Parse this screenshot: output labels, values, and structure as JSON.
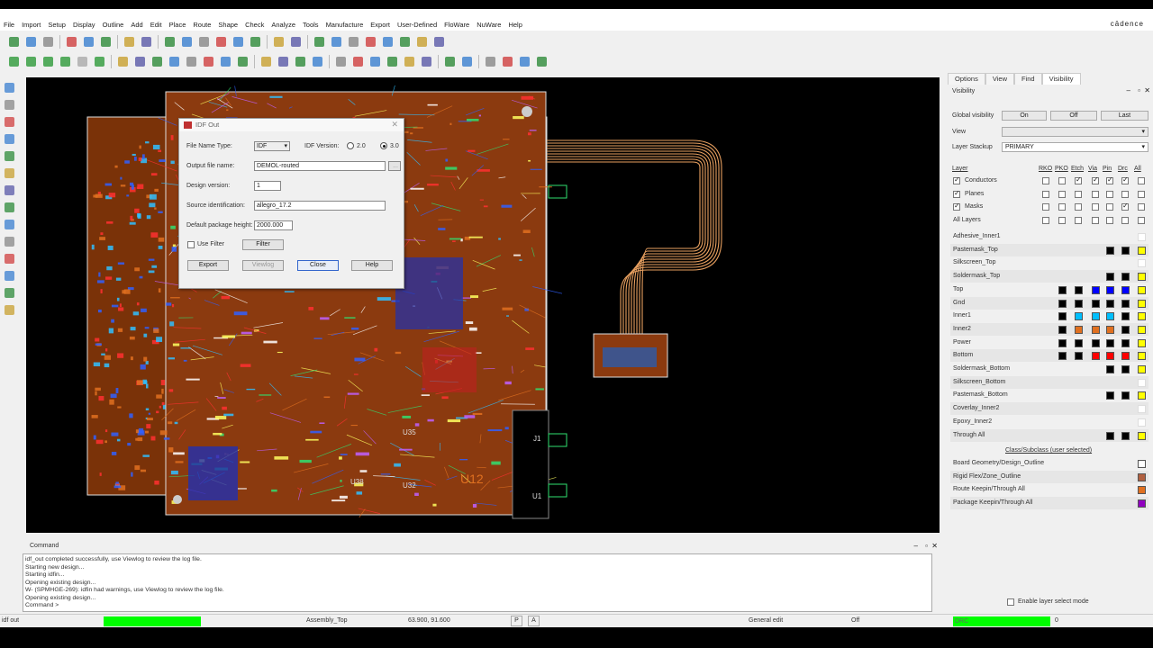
{
  "brand": "cādence",
  "menu": [
    "File",
    "Import",
    "Setup",
    "Display",
    "Outline",
    "Add",
    "Edit",
    "Place",
    "Route",
    "Shape",
    "Check",
    "Analyze",
    "Tools",
    "Manufacture",
    "Export",
    "User-Defined",
    "FloWare",
    "NuWare",
    "Help"
  ],
  "toolbar_row1_icons": [
    "new-icon",
    "open-icon",
    "save-icon",
    "move-icon",
    "copy-icon",
    "delete-icon",
    "undo-icon",
    "redo-icon",
    "zoom-fit-icon",
    "zoom-in-icon",
    "zoom-out-icon",
    "zoom-world-icon",
    "zoom-previous-icon",
    "redraw-icon",
    "3d-icon",
    "refresh-icon",
    "info-icon",
    "property-icon",
    "light-icon",
    "grid-icon",
    "sun-icon",
    "shape-icon",
    "drc-icon",
    "cross-icon"
  ],
  "toolbar_row2_icons": [
    "layer-green-icon",
    "layer-green-icon",
    "layer-green-icon",
    "layer-green-icon",
    "layer-gray-icon",
    "layer-green-icon",
    "add-line-icon",
    "add-rect-icon",
    "add-circle-icon",
    "add-frect-icon",
    "add-shape-icon",
    "add-void-icon",
    "add-text-icon",
    "add-via-icon",
    "place-icon",
    "dimension-icon",
    "fanout-icon",
    "spread-icon",
    "swap-icon",
    "align-icon",
    "group-icon",
    "route-icon",
    "slide-icon",
    "glossing-icon",
    "show-element-icon",
    "drc-marker-icon",
    "manufacturing-icon",
    "artwork-icon",
    "view-icon",
    "3d-view-icon"
  ],
  "canvas_labels": [
    "U35",
    "U38",
    "U32",
    "U12",
    "J1",
    "U1"
  ],
  "dialog": {
    "title": "IDF Out",
    "file_type_label": "File Name Type:",
    "file_type_value": "IDF",
    "idf_version_label": "IDF Version:",
    "version_20": "2.0",
    "version_30": "3.0",
    "output_label": "Output file name:",
    "output_value": "DEMOL-routed",
    "design_version_label": "Design version:",
    "design_version_value": "1",
    "source_label": "Source identification:",
    "source_value": "allegro_17.2",
    "pkg_height_label": "Default package height:",
    "pkg_height_value": "2000.000",
    "use_filter_label": "Use Filter",
    "filter_btn": "Filter",
    "export_btn": "Export",
    "viewlog_btn": "Viewlog",
    "close_btn": "Close",
    "help_btn": "Help",
    "browse_btn": "..."
  },
  "panel": {
    "tabs": [
      "Options",
      "View",
      "Find",
      "Visibility"
    ],
    "title": "Visibility",
    "global_visibility": "Global visibility",
    "on": "On",
    "off": "Off",
    "last": "Last",
    "view": "View",
    "layer_stackup": "Layer Stackup",
    "stackup_value": "PRIMARY",
    "layer_header": "Layer",
    "col_heads": [
      "RKO",
      "PKO",
      "Etch",
      "Via",
      "Pin",
      "Drc",
      "All"
    ],
    "group_rows": [
      "Conductors",
      "Planes",
      "Masks",
      "All Layers"
    ],
    "layers": [
      {
        "name": "Adhesive_Inner1",
        "colors": []
      },
      {
        "name": "Pastemask_Top",
        "colors": [
          "#000000",
          "#000000",
          "#ffff00"
        ]
      },
      {
        "name": "Silkscreen_Top",
        "colors": []
      },
      {
        "name": "Soldermask_Top",
        "colors": [
          "#000000",
          "#000000",
          "#ffff00"
        ]
      },
      {
        "name": "Top",
        "colors": [
          "#000000",
          "#000000",
          "#0000ff",
          "#0000ff",
          "#0000ff",
          "#ffff00"
        ]
      },
      {
        "name": "Gnd",
        "colors": [
          "#000000",
          "#000000",
          "#000000",
          "#000000",
          "#000000",
          "#ffff00"
        ]
      },
      {
        "name": "Inner1",
        "colors": [
          "#000000",
          "#00bfff",
          "#00bfff",
          "#00bfff",
          "#000000",
          "#ffff00"
        ]
      },
      {
        "name": "Inner2",
        "colors": [
          "#000000",
          "#e07020",
          "#e07020",
          "#e07020",
          "#000000",
          "#ffff00"
        ]
      },
      {
        "name": "Power",
        "colors": [
          "#000000",
          "#000000",
          "#000000",
          "#000000",
          "#000000",
          "#ffff00"
        ]
      },
      {
        "name": "Bottom",
        "colors": [
          "#000000",
          "#000000",
          "#ff0000",
          "#ff0000",
          "#ff0000",
          "#ffff00"
        ]
      },
      {
        "name": "Soldermask_Bottom",
        "colors": [
          "#000000",
          "#000000",
          "#ffff00"
        ]
      },
      {
        "name": "Silkscreen_Bottom",
        "colors": []
      },
      {
        "name": "Pastemask_Bottom",
        "colors": [
          "#000000",
          "#000000",
          "#ffff00"
        ]
      },
      {
        "name": "Coverlay_Inner2",
        "colors": []
      },
      {
        "name": "Epoxy_Inner2",
        "colors": []
      },
      {
        "name": "Through All",
        "colors": [
          "#000000",
          "#000000",
          "#ffff00"
        ]
      }
    ],
    "class_header": "Class/Subclass (user selected)",
    "class_rows": [
      {
        "name": "Board Geometry/Design_Outline",
        "color": "#ffffff"
      },
      {
        "name": "Rigid Flex/Zone_Outline",
        "color": "#b06040"
      },
      {
        "name": "Route Keepin/Through All",
        "color": "#e07020"
      },
      {
        "name": "Package Keepin/Through All",
        "color": "#9000c0"
      }
    ],
    "enable_layer_select": "Enable layer select mode"
  },
  "command": {
    "title": "Command",
    "lines": [
      "idf_out completed successfully, use Viewlog to review the log file.",
      "Starting new design...",
      "Starting idfin...",
      "Opening existing design...",
      "W- (SPMHGE-269): idfin had warnings, use Viewlog to review the log file.",
      "Opening existing design...",
      "Command >"
    ]
  },
  "status": {
    "command": "idf out",
    "subclass": "Assembly_Top",
    "coords": "63.900, 91.600",
    "p": "P",
    "a": "A",
    "mode": "General edit",
    "off": "Off",
    "drc": "DRC",
    "drc_count": "0"
  },
  "colors": {
    "accent_green": "#00ff00",
    "board": "#8b3a0f",
    "flex_trace": "#e8a060"
  }
}
